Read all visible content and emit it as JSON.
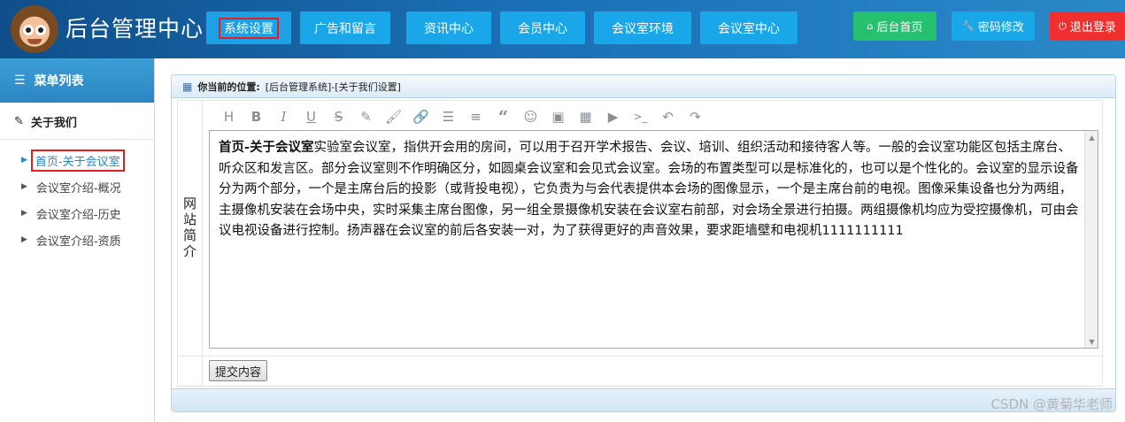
{
  "header": {
    "title": "后台管理中心",
    "nav": [
      {
        "label": "系统设置",
        "active": true
      },
      {
        "label": "广告和留言"
      },
      {
        "label": "资讯中心"
      },
      {
        "label": "会员中心"
      },
      {
        "label": "会议室环境"
      },
      {
        "label": "会议室中心"
      }
    ],
    "actions": {
      "home": {
        "label": "后台首页",
        "icon": "home-icon"
      },
      "password": {
        "label": "密码修改",
        "icon": "wrench-icon"
      },
      "logout": {
        "label": "退出登录",
        "icon": "power-icon"
      }
    }
  },
  "sidebar": {
    "title": "菜单列表",
    "group": "关于我们",
    "items": [
      {
        "label": "首页-关于会议室",
        "active": true
      },
      {
        "label": "会议室介绍-概况"
      },
      {
        "label": "会议室介绍-历史"
      },
      {
        "label": "会议室介绍-资质"
      }
    ]
  },
  "main": {
    "location_label": "你当前的位置:",
    "location_path": "[后台管理系统]-[关于我们设置]",
    "field_label": "网站简介",
    "editor": {
      "bold_title": "首页-关于会议室",
      "body": "实验室会议室，指供开会用的房间，可以用于召开学术报告、会议、培训、组织活动和接待客人等。一般的会议室功能区包括主席台、听众区和发言区。部分会议室则不作明确区分，如圆桌会议室和会见式会议室。会场的布置类型可以是标准化的，也可以是个性化的。会议室的显示设备分为两个部分，一个是主席台后的投影（或背投电视），它负责为与会代表提供本会场的图像显示，一个是主席台前的电视。图像采集设备也分为两组，主摄像机安装在会场中央，实时采集主席台图像，另一组全景摄像机安装在会议室右前部，对会场全景进行拍摄。两组摄像机均应为受控摄像机，可由会议电视设备进行控制。扬声器在会议室的前后各安装一对，为了获得更好的声音效果，要求距墙壁和电视机1111111111"
    },
    "submit_label": "提交内容"
  },
  "watermark": "CSDN @黄菊华老师"
}
